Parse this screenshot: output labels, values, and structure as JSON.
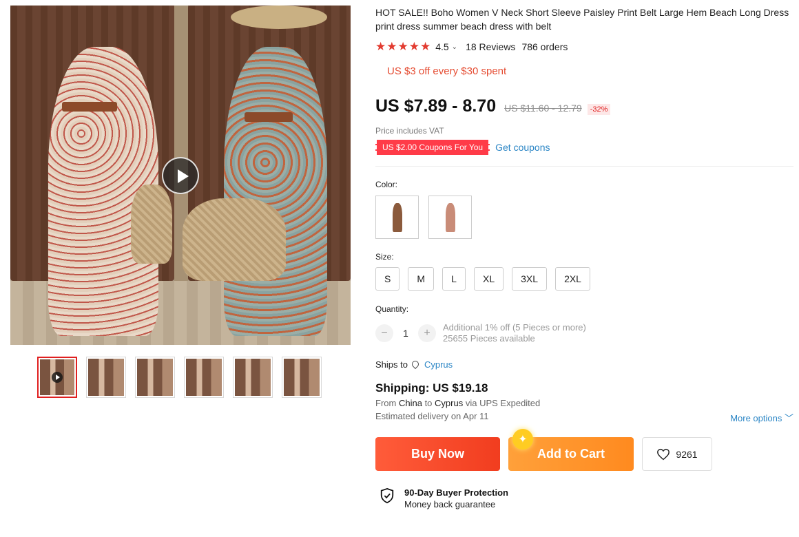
{
  "product": {
    "title": "HOT SALE!! Boho Women V Neck Short Sleeve Paisley Print Belt Large Hem Beach Long Dress print dress summer beach dress with belt",
    "stars": "★★★★★",
    "rating": "4.5",
    "reviews": "18 Reviews",
    "orders": "786 orders",
    "store_promo": "US $3 off every $30 spent",
    "price": "US $7.89 - 8.70",
    "original_price": "US $11.60 - 12.79",
    "discount": "-32%",
    "vat_note": "Price includes VAT",
    "coupon_tag": "US $2.00 Coupons For You",
    "get_coupons": "Get coupons"
  },
  "gallery": {
    "thumbnail_count": 6,
    "active_thumbnail": 0
  },
  "color": {
    "label": "Color:",
    "swatch_colors": [
      "#8b5a3c",
      "#c98c78"
    ]
  },
  "size": {
    "label": "Size:",
    "options": [
      "S",
      "M",
      "L",
      "XL",
      "3XL",
      "2XL"
    ]
  },
  "quantity": {
    "label": "Quantity:",
    "minus": "−",
    "value": "1",
    "plus": "+",
    "bulk_offer": "Additional 1% off (5 Pieces or more)",
    "available": "25655 Pieces available"
  },
  "shipping": {
    "ships_to_label": "Ships to",
    "destination": "Cyprus",
    "cost": "Shipping: US $19.18",
    "from_label": "From",
    "from": "China",
    "to_label": "to",
    "to": "Cyprus",
    "via_label": "via",
    "carrier": "UPS Expedited",
    "delivery": "Estimated delivery on Apr 11",
    "more_options": "More options",
    "more_chevron": "﹀"
  },
  "actions": {
    "buy_now": "Buy Now",
    "add_to_cart": "Add to Cart",
    "wishlist_count": "9261"
  },
  "protection": {
    "title": "90-Day Buyer Protection",
    "subtitle": "Money back guarantee"
  },
  "colors": {
    "price_red": "#e23b30",
    "link_blue": "#2a85c5",
    "buy_now": "#f13d1f",
    "add_cart": "#ff8a1f"
  }
}
